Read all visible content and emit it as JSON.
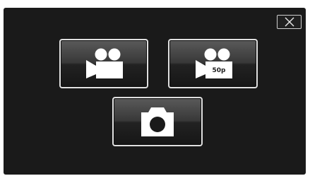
{
  "screen": {
    "close_button": {
      "icon": "close-icon"
    },
    "modes": [
      {
        "name": "video",
        "icon": "video-camera-icon"
      },
      {
        "name": "video-50p",
        "icon": "video-camera-icon",
        "badge": "50p"
      },
      {
        "name": "photo",
        "icon": "photo-camera-icon"
      }
    ]
  },
  "colors": {
    "background": "#1a1a1a",
    "button_border": "#e0e0e0",
    "icon": "#ffffff"
  }
}
